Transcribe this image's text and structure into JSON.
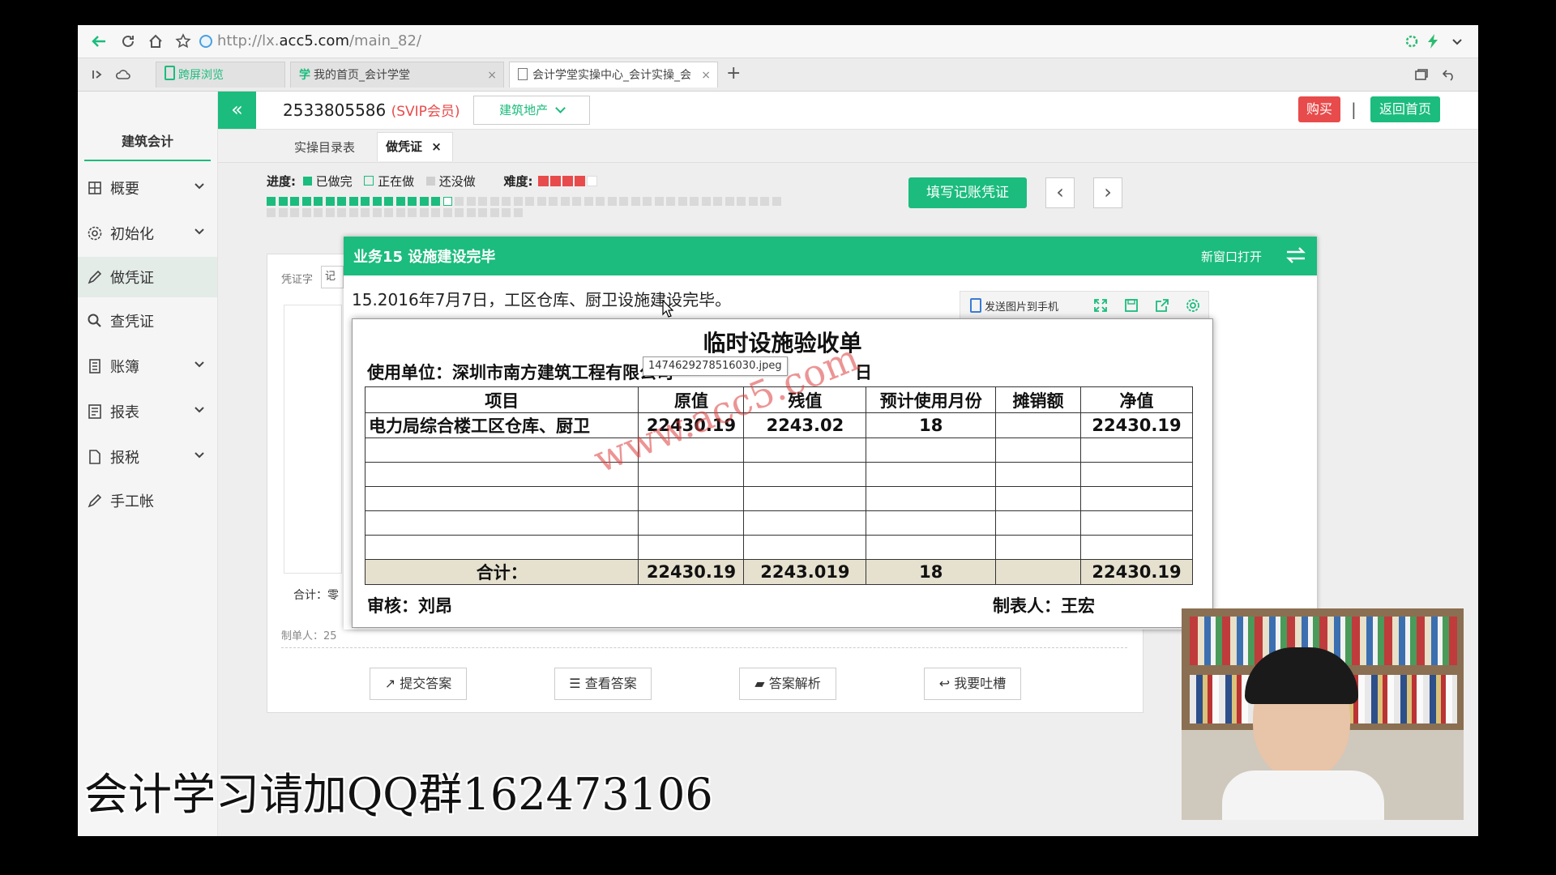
{
  "browser": {
    "url_prefix": "http://lx.",
    "url_host": "acc5.com",
    "url_path": "/main_82/",
    "tabs": [
      {
        "label": "跨屏浏览"
      },
      {
        "label": "我的首页_会计学堂"
      },
      {
        "label": "会计学堂实操中心_会计实操_会"
      }
    ],
    "new_tab": "+"
  },
  "sidebar": {
    "title": "建筑会计",
    "items": [
      {
        "label": "概要"
      },
      {
        "label": "初始化"
      },
      {
        "label": "做凭证"
      },
      {
        "label": "查凭证"
      },
      {
        "label": "账簿"
      },
      {
        "label": "报表"
      },
      {
        "label": "报税"
      },
      {
        "label": "手工帐"
      }
    ]
  },
  "topbar": {
    "collapse": "«",
    "account": "2533805586",
    "member": "(SVIP会员)",
    "industry": "建筑地产",
    "buy": "购买",
    "separator": "|",
    "home": "返回首页"
  },
  "subtabs": {
    "list": "实操目录表",
    "current": "做凭证",
    "close": "×"
  },
  "progress": {
    "label": "进度:",
    "done": "已做完",
    "doing": "正在做",
    "todo": "还没做",
    "difficulty_label": "难度:",
    "difficulty": 4,
    "difficulty_max": 5,
    "done_count": 15,
    "total": 66,
    "fill_button": "填写记账凭证",
    "prev": "‹",
    "next": "›"
  },
  "voucher": {
    "word_label": "凭证字",
    "word_value": "记",
    "total_label": "合计：零元",
    "maker_label": "制单人：25"
  },
  "actions": [
    {
      "label": "提交答案"
    },
    {
      "label": "查看答案"
    },
    {
      "label": "答案解析"
    },
    {
      "label": "我要吐槽"
    }
  ],
  "modal": {
    "title": "业务15 设施建设完毕",
    "open_new": "新窗口打开",
    "description": "15.2016年7月7日，工区仓库、厨卫设施建设完毕。",
    "send_phone": "发送图片到手机",
    "tooltip": "1474629278516030.jpeg"
  },
  "doc": {
    "title": "临时设施验收单",
    "unit_label": "使用单位：深圳市南方建筑工程有限公司",
    "date_tail": "日",
    "headers": [
      "项目",
      "原值",
      "残值",
      "预计使用月份",
      "摊销额",
      "净值"
    ],
    "rows": [
      [
        "电力局综合楼工区仓库、厨卫",
        "22430.19",
        "2243.02",
        "18",
        "",
        "22430.19"
      ],
      [
        "",
        "",
        "",
        "",
        "",
        ""
      ],
      [
        "",
        "",
        "",
        "",
        "",
        ""
      ],
      [
        "",
        "",
        "",
        "",
        "",
        ""
      ],
      [
        "",
        "",
        "",
        "",
        "",
        ""
      ],
      [
        "",
        "",
        "",
        "",
        "",
        ""
      ]
    ],
    "total": [
      "合计：",
      "22430.19",
      "2243.019",
      "18",
      "",
      "22430.19"
    ],
    "auditor": "审核：刘昂",
    "maker": "制表人：王宏",
    "watermark": "www.acc5.com"
  },
  "overlay_text": "会计学习请加QQ群162473106",
  "colors": {
    "accent": "#1bbc7d",
    "red": "#e84b4b",
    "watermark": "#dc3c3c"
  }
}
